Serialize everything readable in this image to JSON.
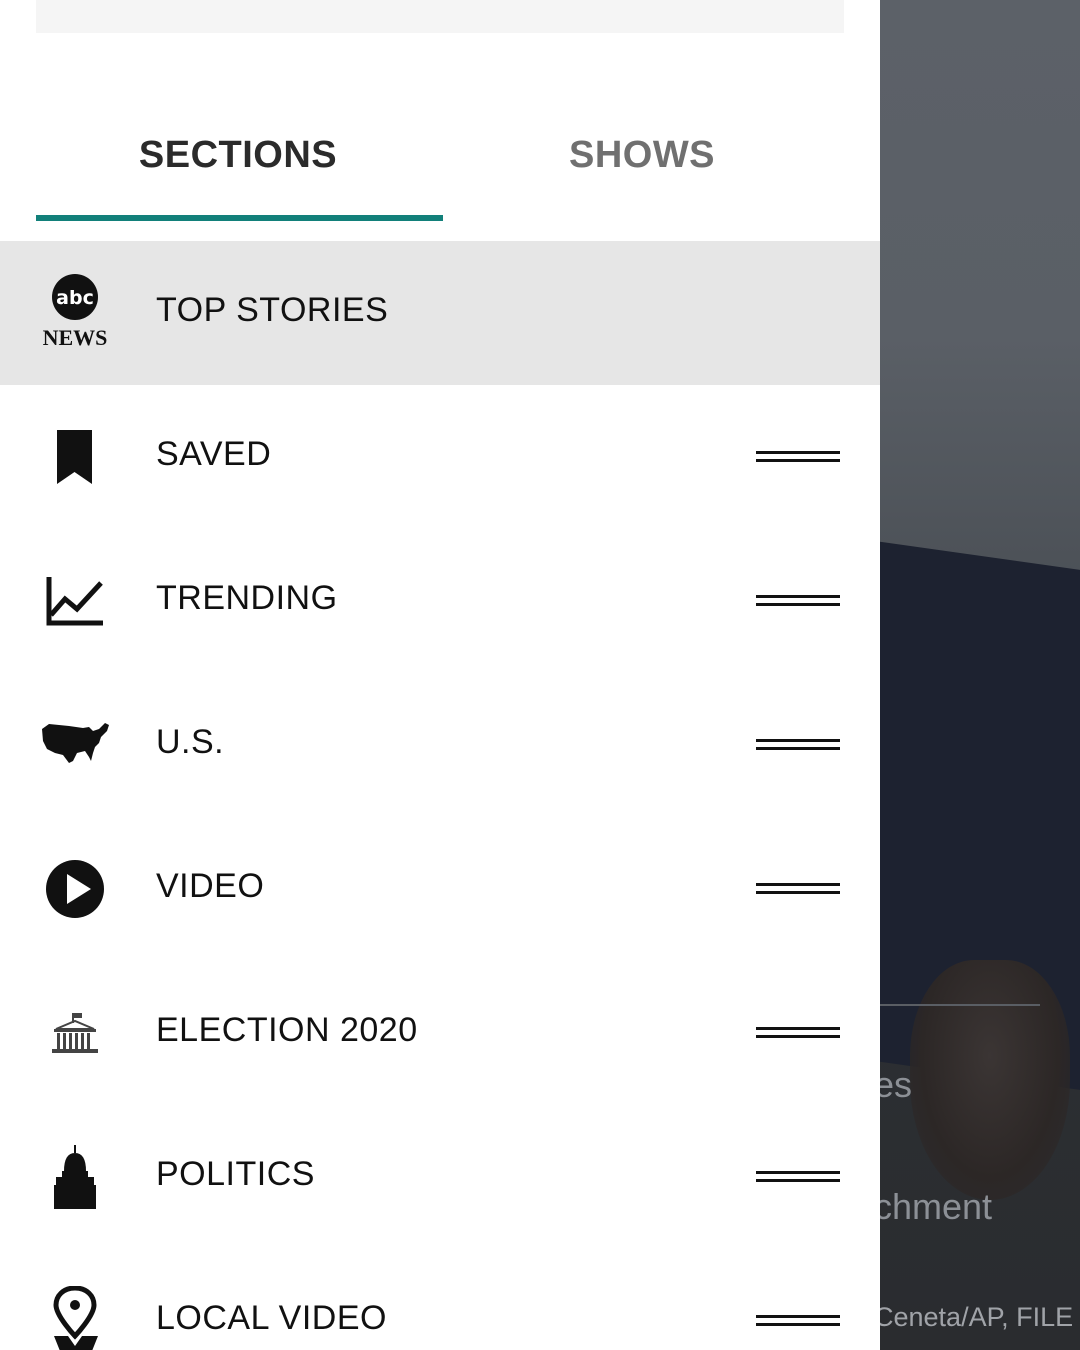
{
  "drawer": {
    "tabs": [
      {
        "label": "SECTIONS",
        "active": true
      },
      {
        "label": "SHOWS",
        "active": false
      }
    ],
    "accent_color": "#12807a",
    "items": [
      {
        "label": "TOP STORIES",
        "icon": "abc-news-logo",
        "selected": true
      },
      {
        "label": "SAVED",
        "icon": "bookmark-icon"
      },
      {
        "label": "TRENDING",
        "icon": "trending-chart-icon"
      },
      {
        "label": "U.S.",
        "icon": "us-map-icon"
      },
      {
        "label": "VIDEO",
        "icon": "play-icon"
      },
      {
        "label": "ELECTION 2020",
        "icon": "white-house-icon"
      },
      {
        "label": "POLITICS",
        "icon": "capitol-icon"
      },
      {
        "label": "LOCAL VIDEO",
        "icon": "location-pin-icon"
      }
    ],
    "logo": {
      "top": "abc",
      "bottom": "NEWS"
    }
  },
  "background": {
    "fragment_1": "es",
    "fragment_2": "chment",
    "credit_fragment": "Ceneta/AP, FILE"
  }
}
